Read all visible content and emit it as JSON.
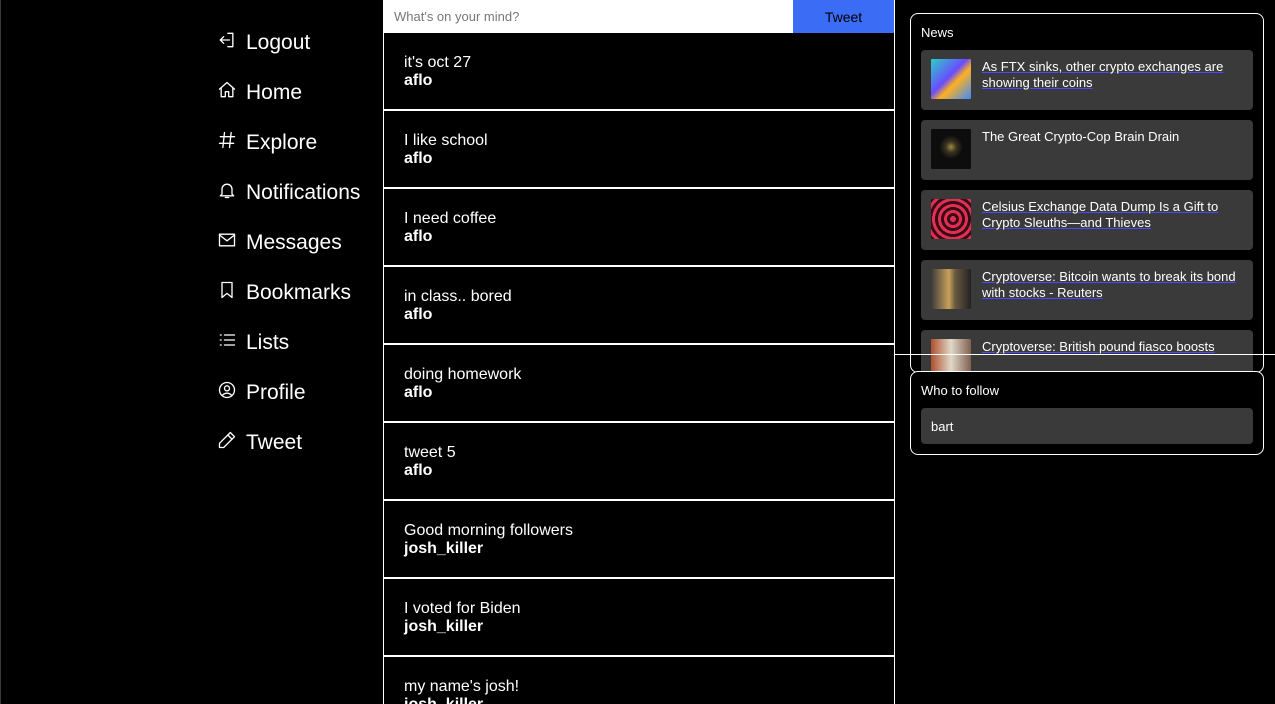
{
  "sidebar": {
    "items": [
      {
        "label": "Logout",
        "icon": "logout-icon"
      },
      {
        "label": "Home",
        "icon": "home-icon"
      },
      {
        "label": "Explore",
        "icon": "hashtag-icon"
      },
      {
        "label": "Notifications",
        "icon": "bell-icon"
      },
      {
        "label": "Messages",
        "icon": "envelope-icon"
      },
      {
        "label": "Bookmarks",
        "icon": "bookmark-icon"
      },
      {
        "label": "Lists",
        "icon": "list-icon"
      },
      {
        "label": "Profile",
        "icon": "user-circle-icon"
      },
      {
        "label": "Tweet",
        "icon": "pencil-icon"
      }
    ]
  },
  "compose": {
    "placeholder": "What's on your mind?",
    "button_label": "Tweet",
    "button_color": "#3b6cf6"
  },
  "tweets": [
    {
      "text": "it's oct 27",
      "user": "aflo"
    },
    {
      "text": "I like school",
      "user": "aflo"
    },
    {
      "text": "I need coffee",
      "user": "aflo"
    },
    {
      "text": "in class.. bored",
      "user": "aflo"
    },
    {
      "text": "doing homework",
      "user": "aflo"
    },
    {
      "text": "tweet 5",
      "user": "aflo"
    },
    {
      "text": "Good morning followers",
      "user": "josh_killer"
    },
    {
      "text": "I voted for Biden",
      "user": "josh_killer"
    },
    {
      "text": "my name's josh!",
      "user": "josh_killer"
    }
  ],
  "news": {
    "title": "News",
    "items": [
      {
        "title": "As FTX sinks, other crypto exchanges are showing their coins",
        "thumb": "linear-gradient(135deg,#2ad0c8,#6a4cff 45%,#ffb020 60%,#3a8cff)"
      },
      {
        "title": "The Great Crypto-Cop Brain Drain",
        "thumb": "radial-gradient(circle at 50% 45%,#a08a40 0,#3a3320 18%,#0d0d0d 40%)"
      },
      {
        "title": "Celsius Exchange Data Dump Is a Gift to Crypto Sleuths—and Thieves",
        "thumb": "repeating-radial-gradient(circle at 55% 50%,#e03050 0,#e03050 3px,#3a0a18 3px,#3a0a18 6px)"
      },
      {
        "title": "Cryptoverse: Bitcoin wants to break its bond with stocks - Reuters",
        "thumb": "linear-gradient(90deg,#3a3a3a,#c9a25a 45%,#6a5a40 60%,#222)"
      },
      {
        "title": "Cryptoverse: British pound fiasco boosts",
        "thumb": "linear-gradient(90deg,#b05030,#e0d8c8 50%,#806050)"
      }
    ]
  },
  "follow": {
    "title": "Who to follow",
    "items": [
      {
        "name": "bart"
      }
    ]
  }
}
